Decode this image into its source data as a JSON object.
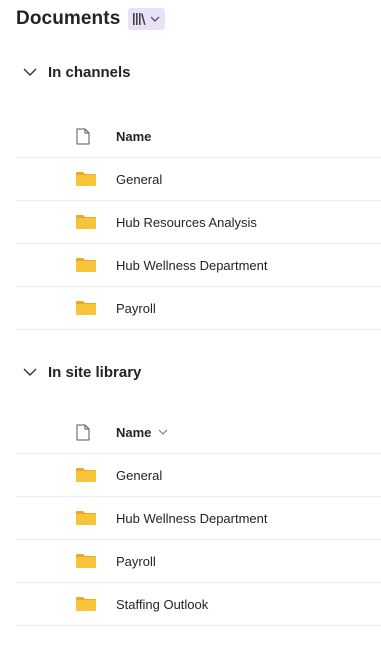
{
  "header": {
    "title": "Documents"
  },
  "sections": [
    {
      "title": "In channels",
      "column_name": "Name",
      "rows": [
        "General",
        "Hub Resources Analysis",
        "Hub Wellness Department",
        "Payroll"
      ]
    },
    {
      "title": "In site library",
      "column_name": "Name",
      "rows": [
        "General",
        "Hub Wellness Department",
        "Payroll",
        "Staffing Outlook"
      ]
    }
  ],
  "colors": {
    "folder": "#f8c43a",
    "folder_tab": "#e8a923",
    "accent_bg": "#e8e1f7"
  }
}
